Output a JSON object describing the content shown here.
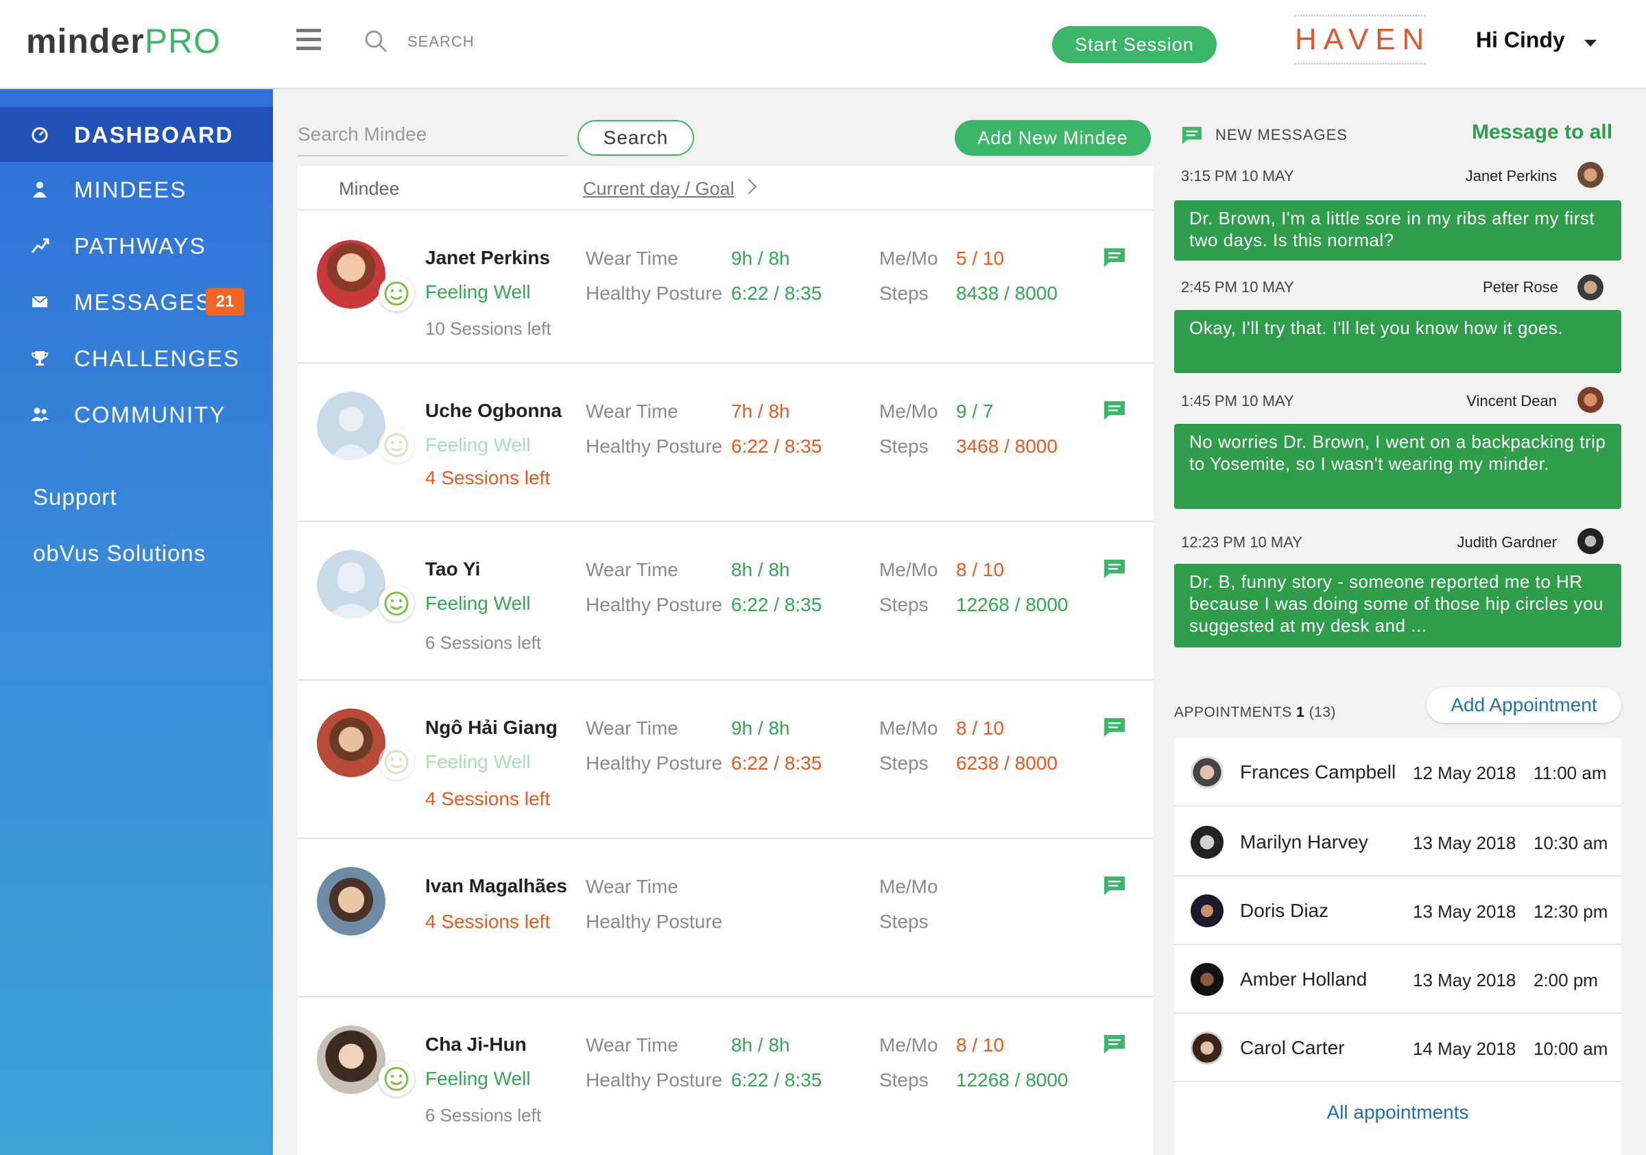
{
  "header": {
    "logo_prefix": "minder",
    "logo_suffix": "PRO",
    "search_label": "SEARCH",
    "start_session": "Start Session",
    "partner_logo": "HAVEN",
    "greeting": "Hi Cindy"
  },
  "colors": {
    "accent_green": "#3cb76a",
    "message_green": "#2e9e4a",
    "warning_orange": "#e85a1d",
    "sidebar_blue": "#2f6fd8",
    "link_blue": "#1f6fb5"
  },
  "sidebar": {
    "items": [
      {
        "label": "DASHBOARD",
        "icon": "dashboard-icon"
      },
      {
        "label": "MINDEES",
        "icon": "person-icon"
      },
      {
        "label": "PATHWAYS",
        "icon": "pathways-icon"
      },
      {
        "label": "MESSAGES",
        "icon": "envelope-icon",
        "badge": "21"
      },
      {
        "label": "CHALLENGES",
        "icon": "trophy-icon"
      },
      {
        "label": "COMMUNITY",
        "icon": "group-icon"
      }
    ],
    "links": [
      "Support",
      "obVus Solutions"
    ]
  },
  "mindees": {
    "search_placeholder": "Search Mindee",
    "search_button": "Search",
    "add_button": "Add New Mindee",
    "col_mindee": "Mindee",
    "col_current": "Current day / Goal",
    "labels": {
      "wear_time": "Wear Time",
      "healthy_posture": "Healthy Posture",
      "me_mo": "Me/Mo",
      "steps": "Steps"
    },
    "rows": [
      {
        "name": "Janet Perkins",
        "feeling": "Feeling Well",
        "sessions": "10 Sessions left",
        "wear": "9h / 8h",
        "posture": "6:22 / 8:35",
        "memo": "5 / 10",
        "steps": "8438 / 8000"
      },
      {
        "name": "Uche Ogbonna",
        "feeling": "Feeling Well",
        "sessions": "4 Sessions left",
        "wear": "7h / 8h",
        "posture": "6:22 / 8:35",
        "memo": "9 / 7",
        "steps": "3468 / 8000"
      },
      {
        "name": "Tao Yi",
        "feeling": "Feeling Well",
        "sessions": "6 Sessions left",
        "wear": "8h / 8h",
        "posture": "6:22 / 8:35",
        "memo": "8 / 10",
        "steps": "12268 / 8000"
      },
      {
        "name": "Ngô Hải Giang",
        "feeling": "Feeling Well",
        "sessions": "4 Sessions left",
        "wear": "9h / 8h",
        "posture": "6:22 / 8:35",
        "memo": "8 / 10",
        "steps": "6238 / 8000"
      },
      {
        "name": "Ivan Magalhães",
        "sessions": "4 Sessions left"
      },
      {
        "name": "Cha Ji-Hun",
        "feeling": "Feeling Well",
        "sessions": "6 Sessions left",
        "wear": "8h / 8h",
        "posture": "6:22 / 8:35",
        "memo": "8 / 10",
        "steps": "12268 / 8000"
      }
    ]
  },
  "messages": {
    "header": "NEW MESSAGES",
    "message_all": "Message to all",
    "items": [
      {
        "time": "3:15 PM 10 MAY",
        "sender": "Janet Perkins",
        "text": "Dr. Brown, I'm a little sore in my ribs after my first two days. Is this normal?"
      },
      {
        "time": "2:45 PM 10 MAY",
        "sender": "Peter Rose",
        "text": "Okay, I'll try that. I'll let you know how it goes."
      },
      {
        "time": "1:45 PM 10 MAY",
        "sender": "Vincent Dean",
        "text": "No worries Dr. Brown, I went on a backpacking trip to Yosemite, so I wasn't wearing my minder."
      },
      {
        "time": "12:23 PM 10 MAY",
        "sender": "Judith Gardner",
        "text": "Dr. B, funny story - someone reported me to HR because I was doing some of those hip circles you suggested at my desk and ..."
      }
    ]
  },
  "appointments": {
    "label": "APPOINTMENTS",
    "count_today": "1",
    "count_total": "(13)",
    "add_button": "Add Appointment",
    "all_link": "All appointments",
    "items": [
      {
        "name": "Frances Campbell",
        "date": "12 May 2018",
        "time": "11:00 am"
      },
      {
        "name": "Marilyn Harvey",
        "date": "13 May 2018",
        "time": "10:30 am"
      },
      {
        "name": "Doris Diaz",
        "date": "13 May 2018",
        "time": "12:30 pm"
      },
      {
        "name": "Amber Holland",
        "date": "13 May 2018",
        "time": "2:00 pm"
      },
      {
        "name": "Carol Carter",
        "date": "14 May 2018",
        "time": "10:00 am"
      }
    ]
  }
}
